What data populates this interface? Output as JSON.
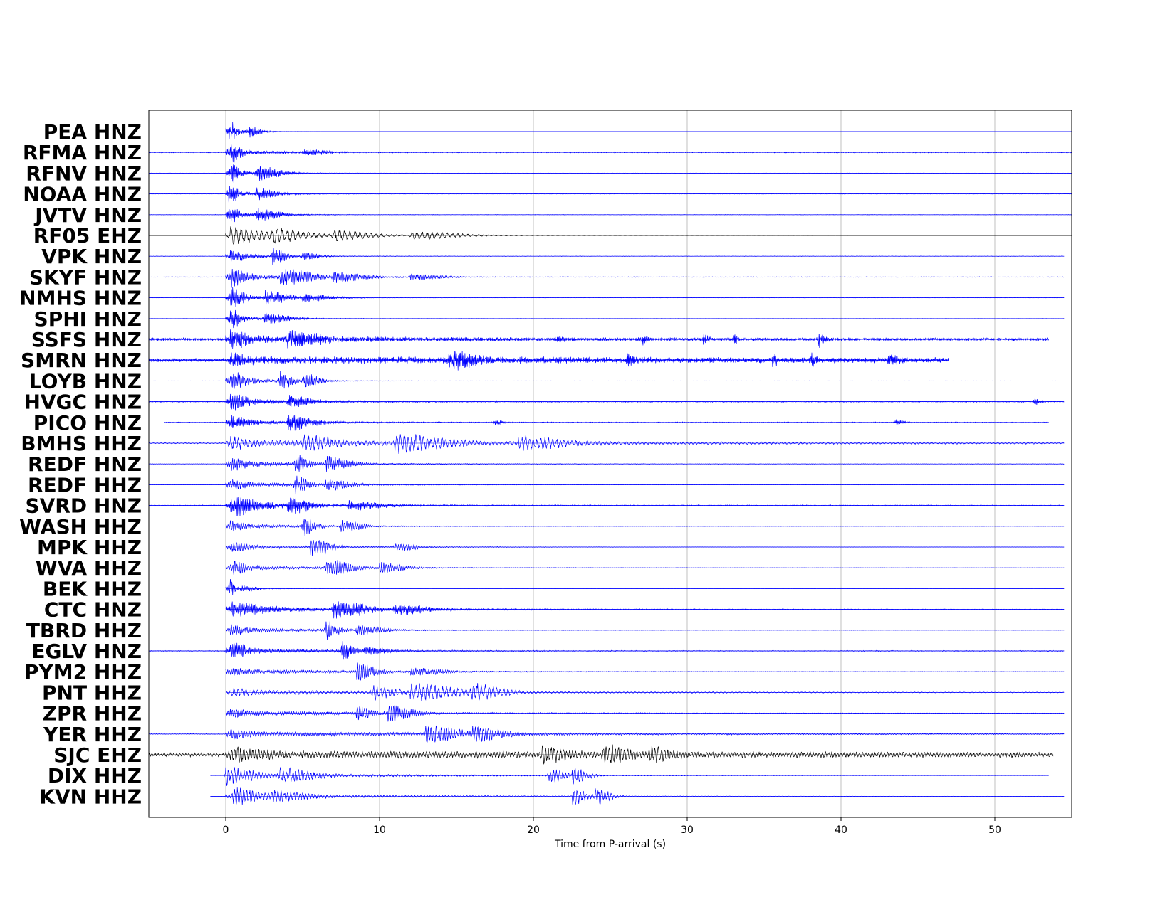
{
  "chart_data": {
    "type": "line",
    "xlabel": "Time from P-arrival (s)",
    "ylabel": "",
    "xlim": [
      -5,
      55
    ],
    "xticks": [
      0,
      10,
      20,
      30,
      40,
      50
    ],
    "grid": "vertical",
    "series": [
      {
        "name": "PEA HNZ",
        "color": "#0000ff",
        "start": 0,
        "end": 55,
        "amp": 0.9,
        "decay": 0.7,
        "noise": 0.0,
        "events": [
          [
            0.2,
            1.0,
            0.4
          ],
          [
            1.5,
            0.5,
            0.8
          ]
        ],
        "freq": 14,
        "seed": 1
      },
      {
        "name": "RFMA HNZ",
        "color": "#0000ff",
        "start": -5,
        "end": 55,
        "amp": 0.75,
        "decay": 0.35,
        "noise": 0.06,
        "events": [
          [
            0.3,
            0.9,
            0.6
          ],
          [
            5,
            0.3,
            1.5
          ]
        ],
        "freq": 13,
        "seed": 2
      },
      {
        "name": "RFNV HNZ",
        "color": "#0000ff",
        "start": -5,
        "end": 55,
        "amp": 0.8,
        "decay": 0.45,
        "noise": 0.02,
        "events": [
          [
            0.3,
            1.0,
            0.5
          ],
          [
            2,
            0.8,
            1.5
          ]
        ],
        "freq": 13,
        "seed": 3
      },
      {
        "name": "NOAA HNZ",
        "color": "#0000ff",
        "start": -5,
        "end": 55,
        "amp": 0.7,
        "decay": 0.4,
        "noise": 0.03,
        "events": [
          [
            0.2,
            1.0,
            0.5
          ],
          [
            2,
            0.6,
            1.2
          ]
        ],
        "freq": 13,
        "seed": 4
      },
      {
        "name": "JVTV HNZ",
        "color": "#0000ff",
        "start": -5,
        "end": 55,
        "amp": 0.75,
        "decay": 0.4,
        "noise": 0.03,
        "events": [
          [
            0.2,
            1.0,
            0.5
          ],
          [
            2,
            0.6,
            1.4
          ]
        ],
        "freq": 13,
        "seed": 5
      },
      {
        "name": "RF05 EHZ",
        "color": "#000000",
        "start": -5,
        "end": 55,
        "amp": 0.5,
        "decay": 0.1,
        "noise": 0.0,
        "events": [
          [
            0.3,
            0.9,
            2
          ],
          [
            3,
            0.7,
            2
          ],
          [
            7,
            0.6,
            2
          ],
          [
            12,
            0.4,
            3
          ]
        ],
        "freq": 3,
        "seed": 6
      },
      {
        "name": "VPK HNZ",
        "color": "#0000ff",
        "start": -5,
        "end": 54.5,
        "amp": 0.5,
        "decay": 0.3,
        "noise": 0.03,
        "events": [
          [
            0.3,
            0.5,
            1
          ],
          [
            3,
            1.0,
            0.8
          ],
          [
            5,
            0.4,
            1
          ]
        ],
        "freq": 10,
        "seed": 7
      },
      {
        "name": "SKYF HNZ",
        "color": "#0000ff",
        "start": -5,
        "end": 54.5,
        "amp": 0.7,
        "decay": 0.2,
        "noise": 0.04,
        "events": [
          [
            0.3,
            0.9,
            1
          ],
          [
            3.5,
            0.9,
            2
          ],
          [
            7,
            0.5,
            2
          ],
          [
            12,
            0.3,
            2
          ]
        ],
        "freq": 10,
        "seed": 8
      },
      {
        "name": "NMHS HNZ",
        "color": "#0000ff",
        "start": -5,
        "end": 54.5,
        "amp": 0.7,
        "decay": 0.35,
        "noise": 0.02,
        "events": [
          [
            0.3,
            1.0,
            0.8
          ],
          [
            2.5,
            0.8,
            1.5
          ],
          [
            5,
            0.4,
            2
          ]
        ],
        "freq": 12,
        "seed": 9
      },
      {
        "name": "SPHI HNZ",
        "color": "#0000ff",
        "start": -5,
        "end": 54.5,
        "amp": 0.6,
        "decay": 0.35,
        "noise": 0.02,
        "events": [
          [
            0.3,
            1.0,
            0.6
          ],
          [
            2.5,
            0.6,
            1.5
          ]
        ],
        "freq": 12,
        "seed": 10
      },
      {
        "name": "SSFS HNZ",
        "color": "#0000ff",
        "start": -5,
        "end": 53.5,
        "amp": 0.6,
        "decay": 0.08,
        "noise": 0.2,
        "events": [
          [
            0.3,
            0.9,
            1
          ],
          [
            4,
            0.8,
            2
          ],
          [
            21.5,
            0.5,
            0.4
          ],
          [
            27,
            0.5,
            0.4
          ],
          [
            31,
            0.5,
            0.4
          ],
          [
            33,
            0.6,
            0.3
          ],
          [
            38.5,
            0.8,
            0.4
          ]
        ],
        "freq": 16,
        "seed": 11
      },
      {
        "name": "SMRN HNZ",
        "color": "#0000ff",
        "start": -5,
        "end": 47,
        "amp": 0.5,
        "decay": 0.02,
        "noise": 0.25,
        "events": [
          [
            0.3,
            0.6,
            1
          ],
          [
            14.5,
            1.0,
            1.5
          ],
          [
            26,
            0.5,
            0.6
          ],
          [
            35.5,
            0.7,
            0.3
          ],
          [
            38,
            0.7,
            0.3
          ],
          [
            43,
            0.4,
            0.8
          ]
        ],
        "freq": 16,
        "seed": 12
      },
      {
        "name": "LOYB HNZ",
        "color": "#0000ff",
        "start": -5,
        "end": 54.5,
        "amp": 0.7,
        "decay": 0.3,
        "noise": 0.02,
        "events": [
          [
            0.3,
            0.8,
            1
          ],
          [
            3.5,
            1.0,
            0.8
          ],
          [
            5,
            0.9,
            1
          ]
        ],
        "freq": 10,
        "seed": 13
      },
      {
        "name": "HVGC HNZ",
        "color": "#0000ff",
        "start": -5,
        "end": 54.5,
        "amp": 0.6,
        "decay": 0.2,
        "noise": 0.08,
        "events": [
          [
            0.3,
            0.9,
            1
          ],
          [
            4,
            0.6,
            1.5
          ],
          [
            52.5,
            0.4,
            0.4
          ]
        ],
        "freq": 14,
        "seed": 14
      },
      {
        "name": "PICO HNZ",
        "color": "#0000ff",
        "start": -4,
        "end": 53.5,
        "amp": 0.6,
        "decay": 0.2,
        "noise": 0.06,
        "events": [
          [
            0.3,
            0.7,
            1
          ],
          [
            4,
            0.9,
            1.5
          ],
          [
            17.5,
            0.3,
            0.5
          ],
          [
            43.5,
            0.3,
            0.6
          ]
        ],
        "freq": 14,
        "seed": 15
      },
      {
        "name": "BMHS HHZ",
        "color": "#0000ff",
        "start": -5,
        "end": 54.5,
        "amp": 0.6,
        "decay": 0.04,
        "noise": 0.08,
        "events": [
          [
            0.3,
            0.5,
            1
          ],
          [
            5,
            0.7,
            2
          ],
          [
            11,
            0.9,
            3
          ],
          [
            19,
            0.7,
            3
          ]
        ],
        "freq": 4,
        "seed": 16
      },
      {
        "name": "REDF HNZ",
        "color": "#0000ff",
        "start": -5,
        "end": 54.5,
        "amp": 0.6,
        "decay": 0.15,
        "noise": 0.03,
        "events": [
          [
            0.3,
            0.5,
            1
          ],
          [
            4.5,
            1.0,
            0.8
          ],
          [
            6.5,
            0.8,
            1.5
          ]
        ],
        "freq": 8,
        "seed": 17
      },
      {
        "name": "REDF HHZ",
        "color": "#0000ff",
        "start": -5,
        "end": 54.5,
        "amp": 0.6,
        "decay": 0.15,
        "noise": 0.02,
        "events": [
          [
            0.3,
            0.3,
            1
          ],
          [
            4.5,
            1.0,
            0.8
          ],
          [
            6.5,
            0.6,
            1.5
          ]
        ],
        "freq": 7,
        "seed": 18
      },
      {
        "name": "SVRD HNZ",
        "color": "#0000ff",
        "start": -5,
        "end": 54.5,
        "amp": 0.6,
        "decay": 0.15,
        "noise": 0.07,
        "events": [
          [
            0.3,
            0.9,
            2
          ],
          [
            4,
            0.9,
            1.5
          ],
          [
            8,
            0.5,
            2
          ]
        ],
        "freq": 14,
        "seed": 19
      },
      {
        "name": "WASH HHZ",
        "color": "#0000ff",
        "start": 0,
        "end": 54.5,
        "amp": 0.5,
        "decay": 0.15,
        "noise": 0.02,
        "events": [
          [
            0.3,
            0.4,
            1
          ],
          [
            5,
            1.0,
            0.8
          ],
          [
            7.5,
            0.7,
            1.2
          ]
        ],
        "freq": 7,
        "seed": 20
      },
      {
        "name": "MPK HHZ",
        "color": "#0000ff",
        "start": 0,
        "end": 54.5,
        "amp": 0.5,
        "decay": 0.12,
        "noise": 0.02,
        "events": [
          [
            0.3,
            0.4,
            1
          ],
          [
            5.5,
            1.0,
            1.2
          ],
          [
            11,
            0.4,
            1.5
          ]
        ],
        "freq": 6,
        "seed": 21
      },
      {
        "name": "WVA HHZ",
        "color": "#0000ff",
        "start": 0,
        "end": 54.5,
        "amp": 0.5,
        "decay": 0.12,
        "noise": 0.02,
        "events": [
          [
            0.3,
            0.6,
            1
          ],
          [
            6.5,
            1.0,
            1.5
          ],
          [
            10,
            0.6,
            1.5
          ]
        ],
        "freq": 7,
        "seed": 22
      },
      {
        "name": "BEK HHZ",
        "color": "#0000ff",
        "start": 0,
        "end": 54.5,
        "amp": 0.6,
        "decay": 0.6,
        "noise": 0.01,
        "events": [
          [
            0.2,
            1.0,
            0.3
          ],
          [
            1,
            0.3,
            0.8
          ]
        ],
        "freq": 10,
        "seed": 23
      },
      {
        "name": "CTC HNZ",
        "color": "#0000ff",
        "start": 0,
        "end": 54.5,
        "amp": 0.6,
        "decay": 0.1,
        "noise": 0.05,
        "events": [
          [
            0.4,
            0.6,
            2
          ],
          [
            7,
            1.0,
            2
          ],
          [
            11,
            0.6,
            2
          ]
        ],
        "freq": 12,
        "seed": 24
      },
      {
        "name": "TBRD HHZ",
        "color": "#0000ff",
        "start": 0,
        "end": 54.5,
        "amp": 0.5,
        "decay": 0.12,
        "noise": 0.02,
        "events": [
          [
            0.3,
            0.4,
            1
          ],
          [
            6.5,
            1.0,
            0.8
          ],
          [
            8.5,
            0.5,
            1.5
          ]
        ],
        "freq": 8,
        "seed": 25
      },
      {
        "name": "EGLV HNZ",
        "color": "#0000ff",
        "start": -5,
        "end": 54.5,
        "amp": 0.6,
        "decay": 0.15,
        "noise": 0.06,
        "events": [
          [
            0.3,
            0.8,
            1
          ],
          [
            7.5,
            1.0,
            0.8
          ],
          [
            9,
            0.4,
            1.5
          ]
        ],
        "freq": 12,
        "seed": 26
      },
      {
        "name": "PYM2 HHZ",
        "color": "#0000ff",
        "start": 0,
        "end": 54.5,
        "amp": 0.5,
        "decay": 0.1,
        "noise": 0.03,
        "events": [
          [
            0.3,
            0.2,
            1
          ],
          [
            8.5,
            1.0,
            1.2
          ],
          [
            12,
            0.4,
            2
          ]
        ],
        "freq": 8,
        "seed": 27
      },
      {
        "name": "PNT HHZ",
        "color": "#0000ff",
        "start": 0,
        "end": 54.5,
        "amp": 0.5,
        "decay": 0.05,
        "noise": 0.03,
        "events": [
          [
            0.3,
            0.3,
            1
          ],
          [
            9.5,
            0.7,
            1.5
          ],
          [
            12,
            0.9,
            3
          ],
          [
            16,
            0.8,
            2
          ]
        ],
        "freq": 4,
        "seed": 28
      },
      {
        "name": "ZPR HHZ",
        "color": "#0000ff",
        "start": 0,
        "end": 54.5,
        "amp": 0.5,
        "decay": 0.08,
        "noise": 0.04,
        "events": [
          [
            0.3,
            0.3,
            1
          ],
          [
            8.5,
            0.7,
            1
          ],
          [
            10.5,
            0.9,
            1.5
          ]
        ],
        "freq": 7,
        "seed": 29
      },
      {
        "name": "YER HHZ",
        "color": "#0000ff",
        "start": -5,
        "end": 54.5,
        "amp": 0.5,
        "decay": 0.04,
        "noise": 0.05,
        "events": [
          [
            0.3,
            0.4,
            1
          ],
          [
            13,
            1.0,
            2
          ],
          [
            16,
            0.7,
            2
          ]
        ],
        "freq": 6,
        "seed": 30
      },
      {
        "name": "SJC EHZ",
        "color": "#000000",
        "start": -5,
        "end": 53.8,
        "amp": 0.5,
        "decay": 0.02,
        "noise": 0.25,
        "events": [
          [
            0.3,
            0.5,
            2
          ],
          [
            20.5,
            0.8,
            1.5
          ],
          [
            24.5,
            0.9,
            1.5
          ],
          [
            27.5,
            0.7,
            1.5
          ]
        ],
        "freq": 5,
        "seed": 31
      },
      {
        "name": "DIX HHZ",
        "color": "#0000ff",
        "start": -1,
        "end": 53.5,
        "amp": 0.6,
        "decay": 0.08,
        "noise": 0.01,
        "events": [
          [
            0.0,
            1.0,
            1.5
          ],
          [
            3.5,
            0.7,
            2
          ],
          [
            21,
            0.9,
            1
          ],
          [
            22.5,
            0.9,
            1
          ]
        ],
        "freq": 5,
        "seed": 32
      },
      {
        "name": "KVN HHZ",
        "color": "#0000ff",
        "start": -1,
        "end": 54.5,
        "amp": 0.6,
        "decay": 0.08,
        "noise": 0.01,
        "events": [
          [
            0.5,
            0.8,
            1.5
          ],
          [
            3,
            0.5,
            2
          ],
          [
            22.5,
            1.0,
            1
          ],
          [
            24,
            0.9,
            1
          ]
        ],
        "freq": 5,
        "seed": 33
      }
    ]
  }
}
